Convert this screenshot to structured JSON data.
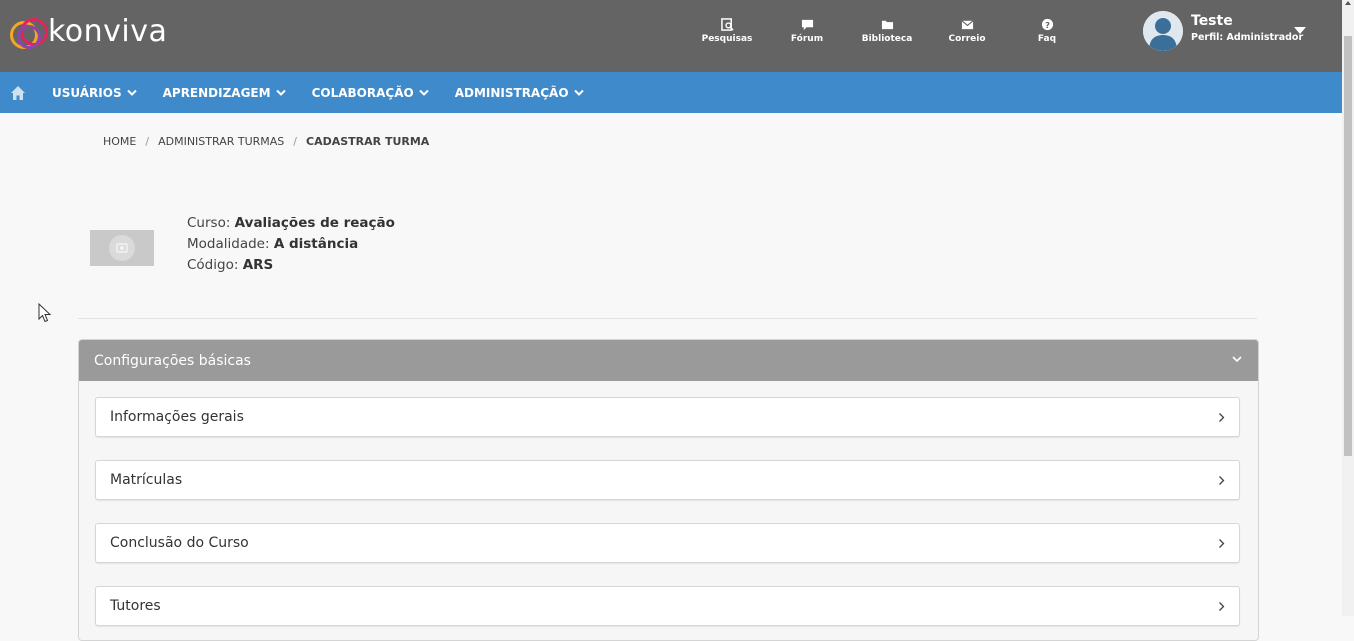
{
  "brand": {
    "logo_text": "konviva"
  },
  "header": {
    "quick_links": [
      {
        "label": "Pesquisas",
        "icon": "search-document-icon"
      },
      {
        "label": "Fórum",
        "icon": "chat-bubble-icon"
      },
      {
        "label": "Biblioteca",
        "icon": "folder-icon"
      },
      {
        "label": "Correio",
        "icon": "envelope-icon"
      },
      {
        "label": "Faq",
        "icon": "question-circle-icon"
      }
    ],
    "user": {
      "name": "Teste",
      "profile": "Perfil: Administrador"
    }
  },
  "nav": {
    "home_icon": "home-icon",
    "items": [
      {
        "label": "USUÁRIOS"
      },
      {
        "label": "APRENDIZAGEM"
      },
      {
        "label": "COLABORAÇÃO"
      },
      {
        "label": "ADMINISTRAÇÃO"
      }
    ]
  },
  "breadcrumb": {
    "items": [
      "HOME",
      "ADMINISTRAR TURMAS",
      "CADASTRAR TURMA"
    ],
    "separator": "/"
  },
  "course": {
    "curso_label": "Curso:",
    "curso_value": "Avaliações de reação",
    "modalidade_label": "Modalidade:",
    "modalidade_value": "A distância",
    "codigo_label": "Código:",
    "codigo_value": "ARS"
  },
  "panel": {
    "title": "Configurações básicas",
    "sections": [
      {
        "label": "Informações gerais"
      },
      {
        "label": "Matrículas"
      },
      {
        "label": "Conclusão do Curso"
      },
      {
        "label": "Tutores"
      }
    ]
  },
  "colors": {
    "header_bg": "#646464",
    "nav_bg": "#3f8acb",
    "panel_head_bg": "#9a9a9a"
  }
}
